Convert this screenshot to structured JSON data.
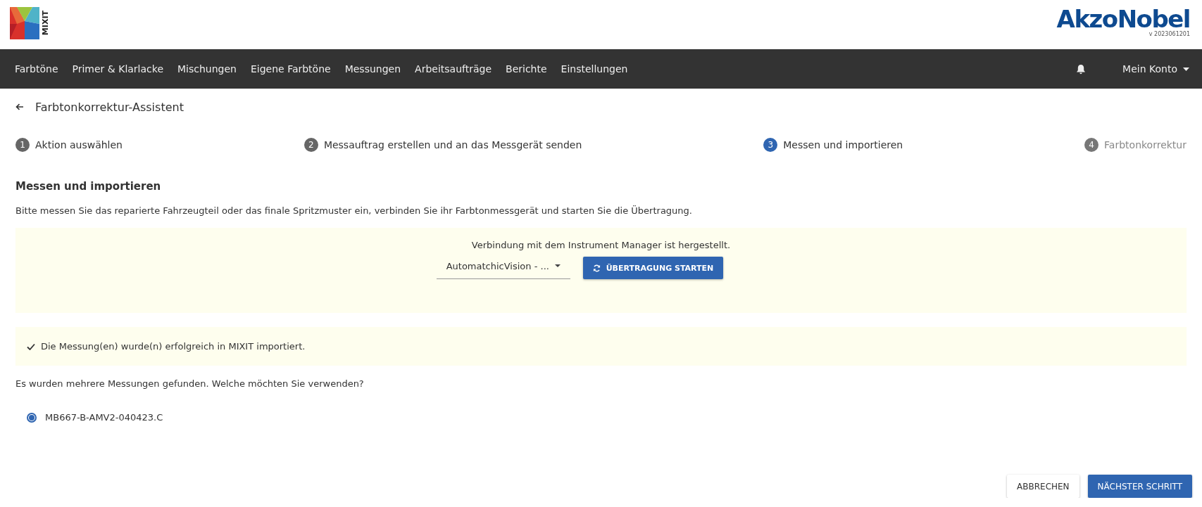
{
  "logo": {
    "text": "MIXIT"
  },
  "brand": {
    "name": "AkzoNobel",
    "version": "v 2023061201"
  },
  "nav": {
    "items": [
      {
        "label": "Farbtöne"
      },
      {
        "label": "Primer & Klarlacke"
      },
      {
        "label": "Mischungen"
      },
      {
        "label": "Eigene Farbtöne"
      },
      {
        "label": "Messungen"
      },
      {
        "label": "Arbeitsaufträge"
      },
      {
        "label": "Berichte"
      },
      {
        "label": "Einstellungen"
      }
    ],
    "account": "Mein Konto"
  },
  "page": {
    "title": "Farbtonkorrektur-Assistent"
  },
  "steps": [
    {
      "number": "1",
      "label": "Aktion auswählen",
      "selected": false,
      "disabled": false
    },
    {
      "number": "2",
      "label": "Messauftrag erstellen und an das Messgerät senden",
      "selected": false,
      "disabled": false
    },
    {
      "number": "3",
      "label": "Messen und importieren",
      "selected": true,
      "disabled": false
    },
    {
      "number": "4",
      "label": "Farbtonkorrektur",
      "selected": false,
      "disabled": true
    }
  ],
  "section": {
    "heading": "Messen und importieren",
    "description": "Bitte messen Sie das reparierte Fahrzeugteil oder das finale Spritzmuster ein, verbinden Sie ihr Farbtonmessgerät und starten Sie die Übertragung."
  },
  "connection": {
    "status": "Verbindung mit dem Instrument Manager ist hergestellt.",
    "device": "AutomatchicVision - ...",
    "button": "ÜBERTRAGUNG STARTEN"
  },
  "success": {
    "message": "Die Messung(en) wurde(n) erfolgreich in MIXIT importiert."
  },
  "question": "Es wurden mehrere Messungen gefunden. Welche möchten Sie verwenden?",
  "measurements": [
    {
      "label": "MB667-B-AMV2-040423.C",
      "selected": true
    }
  ],
  "footer": {
    "buttons": [
      {
        "label": "ABBRECHEN",
        "kind": "secondary"
      },
      {
        "label": "NÄCHSTER SCHRITT",
        "kind": "primary"
      }
    ]
  }
}
